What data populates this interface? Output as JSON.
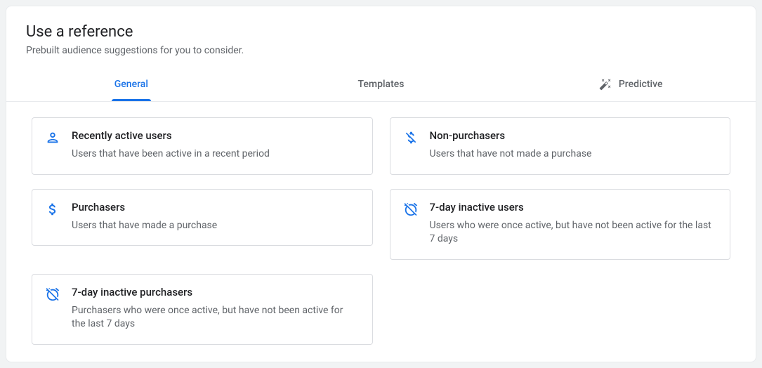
{
  "header": {
    "title": "Use a reference",
    "subtitle": "Prebuilt audience suggestions for you to consider."
  },
  "tabs": {
    "general": "General",
    "templates": "Templates",
    "predictive": "Predictive"
  },
  "cards": {
    "recently_active": {
      "title": "Recently active users",
      "desc": "Users that have been active in a recent period"
    },
    "non_purchasers": {
      "title": "Non-purchasers",
      "desc": "Users that have not made a purchase"
    },
    "purchasers": {
      "title": "Purchasers",
      "desc": "Users that have made a purchase"
    },
    "seven_day_inactive": {
      "title": "7-day inactive users",
      "desc": "Users who were once active, but have not been active for the last 7 days"
    },
    "seven_day_inactive_purchasers": {
      "title": "7-day inactive purchasers",
      "desc": "Purchasers who were once active, but have not been active for the last 7 days"
    }
  }
}
